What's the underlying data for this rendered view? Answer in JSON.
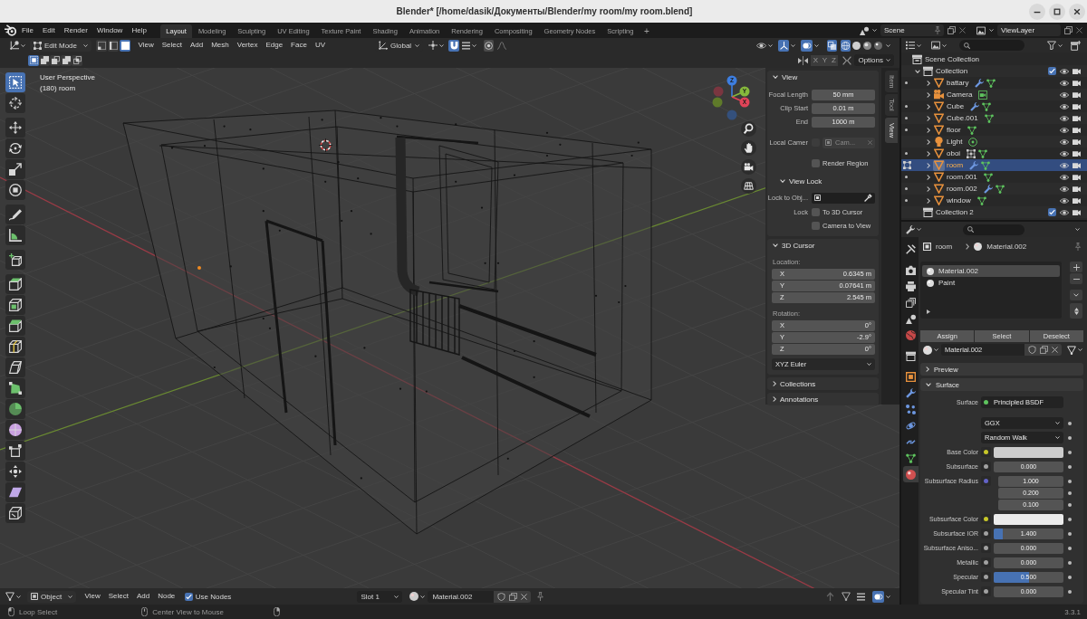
{
  "window": {
    "title": "Blender* [/home/dasik/Документы/Blender/my room/my room.blend]"
  },
  "topbar": {
    "menus": [
      "File",
      "Edit",
      "Render",
      "Window",
      "Help"
    ],
    "workspaces": [
      {
        "label": "Layout",
        "selected": true
      },
      {
        "label": "Modeling",
        "selected": false
      },
      {
        "label": "Sculpting",
        "selected": false
      },
      {
        "label": "UV Editing",
        "selected": false
      },
      {
        "label": "Texture Paint",
        "selected": false
      },
      {
        "label": "Shading",
        "selected": false
      },
      {
        "label": "Animation",
        "selected": false
      },
      {
        "label": "Rendering",
        "selected": false
      },
      {
        "label": "Compositing",
        "selected": false
      },
      {
        "label": "Geometry Nodes",
        "selected": false
      },
      {
        "label": "Scripting",
        "selected": false
      }
    ],
    "add_workspace": "+",
    "scene": "Scene",
    "view_layer": "ViewLayer"
  },
  "viewport": {
    "header": {
      "mode": "Edit Mode",
      "select_modes": [
        {
          "selected": false
        },
        {
          "selected": false
        },
        {
          "selected": true
        }
      ],
      "menus": [
        "View",
        "Select",
        "Add",
        "Mesh",
        "Vertex",
        "Edge",
        "Face",
        "UV"
      ],
      "orientation": "Global",
      "snap": true,
      "gizmos": true,
      "overlays": true,
      "xray": true,
      "shading": [
        {
          "selected": true
        },
        {
          "selected": false
        },
        {
          "selected": false
        },
        {
          "selected": false
        }
      ]
    },
    "tool_settings": {
      "select_ops": [
        {
          "selected": true
        },
        {
          "selected": false
        },
        {
          "selected": false
        },
        {
          "selected": false
        },
        {
          "selected": false
        }
      ],
      "mirror_axes": [
        {
          "label": "X",
          "on": false
        },
        {
          "label": "Y",
          "on": false
        },
        {
          "label": "Z",
          "on": false
        }
      ],
      "options": "Options"
    },
    "overlay_text": {
      "view_name": "User Perspective",
      "object_info": "(180) room"
    },
    "gizmo_labels": [
      "X",
      "Y",
      "Z"
    ],
    "tools": [
      {
        "selected": true
      },
      {
        "selected": false
      },
      {
        "selected": false
      },
      {
        "selected": false
      },
      {
        "selected": false
      },
      {
        "selected": false
      },
      {
        "selected": false
      },
      {
        "selected": false
      },
      {
        "selected": false
      },
      {
        "selected": false
      },
      {
        "selected": false
      },
      {
        "selected": false
      },
      {
        "selected": false
      },
      {
        "selected": false
      },
      {
        "selected": false
      },
      {
        "selected": false
      },
      {
        "selected": false
      },
      {
        "selected": false
      },
      {
        "selected": false
      },
      {
        "selected": false
      },
      {
        "selected": false
      }
    ]
  },
  "sidebar": {
    "tabs": [
      {
        "label": "Item",
        "selected": false
      },
      {
        "label": "Tool",
        "selected": false
      },
      {
        "label": "View",
        "selected": true
      }
    ],
    "panels": [
      {
        "title": "View",
        "expanded": true,
        "rows": [
          {
            "kind": "number",
            "label": "Focal Length",
            "value": "50 mm"
          },
          {
            "kind": "number",
            "label": "Clip Start",
            "value": "0.01 m"
          },
          {
            "kind": "number",
            "label": "End",
            "value": "1000 m"
          },
          {
            "kind": "object",
            "label": "Local Camer",
            "checked": false,
            "value": "Cam...",
            "disabled": true
          },
          {
            "kind": "check",
            "text": "Render Region",
            "checked": false
          },
          {
            "kind": "subpanel",
            "title": "View Lock",
            "expanded": true,
            "rows": [
              {
                "kind": "picker",
                "label": "Lock to Obj..."
              },
              {
                "kind": "check",
                "label": "Lock",
                "text": "To 3D Cursor",
                "checked": false
              },
              {
                "kind": "check",
                "text": "Camera to View",
                "checked": false
              }
            ]
          }
        ]
      },
      {
        "title": "3D Cursor",
        "expanded": true,
        "rows": [
          {
            "kind": "heading",
            "label": "Location:"
          },
          {
            "kind": "vector",
            "items": [
              {
                "axis": "X",
                "value": "0.6345 m"
              },
              {
                "axis": "Y",
                "value": "0.07641 m"
              },
              {
                "axis": "Z",
                "value": "2.545 m"
              }
            ]
          },
          {
            "kind": "heading",
            "label": "Rotation:"
          },
          {
            "kind": "vector",
            "items": [
              {
                "axis": "X",
                "value": "0°"
              },
              {
                "axis": "Y",
                "value": "-2.9°"
              },
              {
                "axis": "Z",
                "value": "0°"
              }
            ]
          },
          {
            "kind": "dropdown",
            "value": "XYZ Euler"
          }
        ]
      },
      {
        "title": "Collections",
        "expanded": false
      },
      {
        "title": "Annotations",
        "expanded": false
      }
    ]
  },
  "outliner": {
    "tree": [
      {
        "label": "Scene Collection",
        "kind": "scene_collection",
        "children": [
          {
            "label": "Collection",
            "kind": "collection",
            "expanded": true,
            "checked": true,
            "children": [
              {
                "label": "battary",
                "kind": "mesh",
                "modifier": {
                  "kind": "wrench"
                },
                "expanded": false,
                "editing": false,
                "selected": false
              },
              {
                "label": "Camera",
                "kind": "camera",
                "expanded": false,
                "editing": false,
                "selected": false
              },
              {
                "label": "Cube",
                "kind": "mesh",
                "modifier": {
                  "kind": "wrench"
                },
                "expanded": false,
                "editing": false,
                "selected": false
              },
              {
                "label": "Cube.001",
                "kind": "mesh",
                "expanded": false,
                "editing": false,
                "selected": false
              },
              {
                "label": "floor",
                "kind": "mesh",
                "expanded": false,
                "editing": false,
                "selected": false
              },
              {
                "label": "Light",
                "kind": "light",
                "expanded": false,
                "editing": false,
                "selected": false
              },
              {
                "label": "oboi",
                "kind": "mesh",
                "modifier": {
                  "kind": "grid"
                },
                "expanded": false,
                "editing": false,
                "selected": false
              },
              {
                "label": "room",
                "kind": "mesh",
                "modifier": {
                  "kind": "wrench"
                },
                "expanded": false,
                "editing": true,
                "selected": true
              },
              {
                "label": "room.001",
                "kind": "mesh",
                "expanded": false,
                "editing": false,
                "selected": false
              },
              {
                "label": "room.002",
                "kind": "mesh",
                "modifier": {
                  "kind": "wrench"
                },
                "expanded": false,
                "editing": false,
                "selected": false
              },
              {
                "label": "window",
                "kind": "mesh",
                "expanded": false,
                "editing": false,
                "selected": false
              }
            ]
          },
          {
            "label": "Collection 2",
            "kind": "collection",
            "checked": true
          }
        ]
      }
    ]
  },
  "properties": {
    "tabs": [
      {
        "selected": false
      },
      {
        "selected": false
      },
      {
        "selected": false
      },
      {
        "selected": false
      },
      {
        "selected": false
      },
      {
        "selected": false
      },
      {
        "selected": false
      },
      {
        "selected": false
      },
      {
        "selected": false
      },
      {
        "selected": false
      },
      {
        "selected": false
      },
      {
        "selected": false
      },
      {
        "selected": false
      },
      {
        "selected": true
      }
    ],
    "breadcrumb": [
      "room",
      "Material.002"
    ],
    "material_slots": [
      {
        "label": "Material.002",
        "selected": true
      },
      {
        "label": "Paint",
        "selected": false
      }
    ],
    "slot_buttons": [
      "Assign",
      "Select",
      "Deselect"
    ],
    "material": "Material.002",
    "panels": [
      {
        "title": "Preview",
        "expanded": false
      },
      {
        "title": "Surface",
        "expanded": true,
        "rows": [
          {
            "kind": "shader",
            "label": "Surface",
            "value": "Principled BSDF",
            "color": "#5ec45e"
          },
          {
            "kind": "dropdown",
            "value": "GGX"
          },
          {
            "kind": "dropdown",
            "value": "Random Walk"
          },
          {
            "kind": "color",
            "label": "Base Color",
            "color": "#c7c729",
            "swatch": {
              "color": "#cdcdcd"
            }
          },
          {
            "kind": "number",
            "label": "Subsurface",
            "color": "#a1a1a1",
            "value": "0.000"
          },
          {
            "kind": "vector",
            "label": "Subsurface Radius",
            "color": "#6363c7",
            "values": [
              "1.000",
              "0.200",
              "0.100"
            ]
          },
          {
            "kind": "color",
            "label": "Subsurface Color",
            "color": "#c7c729",
            "swatch": {
              "color": "#ececec"
            }
          },
          {
            "kind": "number",
            "label": "Subsurface IOR",
            "color": "#a1a1a1",
            "value": "1.400",
            "level": 0.13
          },
          {
            "kind": "number",
            "label": "Subsurface Aniso...",
            "color": "#a1a1a1",
            "value": "0.000"
          },
          {
            "kind": "number",
            "label": "Metallic",
            "color": "#a1a1a1",
            "value": "0.000"
          },
          {
            "kind": "number",
            "label": "Specular",
            "color": "#a1a1a1",
            "value": "0.500",
            "level": 0.5
          },
          {
            "kind": "number",
            "label": "Specular Tint",
            "color": "#a1a1a1",
            "value": "0.000"
          }
        ]
      }
    ]
  },
  "node_editor": {
    "header": {
      "object_type": "Object",
      "menus": [
        "View",
        "Select",
        "Add",
        "Node"
      ],
      "use_nodes": {
        "label": "Use Nodes",
        "checked": true
      },
      "slot": "Slot 1",
      "material": "Material.002"
    }
  },
  "status_bar": {
    "hints": [
      "Loop Select",
      "Center View to Mouse"
    ],
    "version": "3.3.1"
  }
}
